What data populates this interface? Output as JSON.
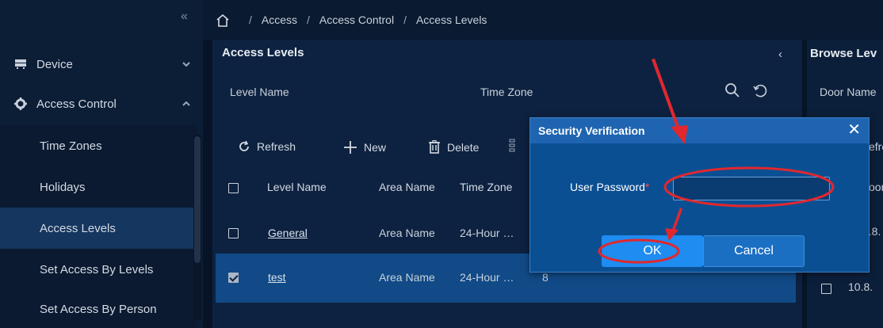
{
  "sidebar": {
    "collapse_glyph": "«",
    "groups": [
      {
        "label": "Device",
        "icon": "device-icon",
        "chevron": "chevron-down"
      },
      {
        "label": "Access Control",
        "icon": "gear-icon",
        "chevron": "chevron-up"
      }
    ],
    "items": [
      {
        "label": "Time Zones"
      },
      {
        "label": "Holidays"
      },
      {
        "label": "Access Levels",
        "active": true
      },
      {
        "label": "Set Access By Levels"
      },
      {
        "label": "Set Access By Person"
      }
    ]
  },
  "breadcrumb": {
    "separator": "/",
    "items": [
      "Access",
      "Access Control",
      "Access Levels"
    ]
  },
  "panel": {
    "title": "Access Levels",
    "back_glyph": "‹",
    "filters": {
      "level_name": "Level Name",
      "time_zone": "Time Zone"
    },
    "toolbar": {
      "refresh": "Refresh",
      "new": "New",
      "delete": "Delete"
    },
    "table": {
      "headers": {
        "level_name": "Level Name",
        "area_name": "Area Name",
        "time_zone": "Time Zone"
      },
      "rows": [
        {
          "level_name": "General",
          "area_name": "Area Name",
          "time_zone": "24-Hour …",
          "extra": "",
          "checked": false
        },
        {
          "level_name": "test",
          "area_name": "Area Name",
          "time_zone": "24-Hour …",
          "extra": "8",
          "checked": true
        }
      ]
    }
  },
  "right_panel": {
    "title": "Browse Lev",
    "filter": "Door Name",
    "toolbar_fragment": "efre",
    "header_fragment": "oor",
    "rows": [
      "0.8.",
      "10.8."
    ]
  },
  "dialog": {
    "title": "Security Verification",
    "close_glyph": "✕",
    "field_label": "User Password",
    "required_mark": "*",
    "field_value": "",
    "ok_label": "OK",
    "cancel_label": "Cancel"
  },
  "colors": {
    "sidebar_bg": "#0c1d36",
    "active_item_bg": "#15365f",
    "selected_row_bg": "#114a86",
    "dialog_bg": "#0b4f93",
    "dialog_header_bg": "#1f64b0",
    "ok_button_bg": "#1e8cf0",
    "annotation_red": "#e0282e"
  }
}
